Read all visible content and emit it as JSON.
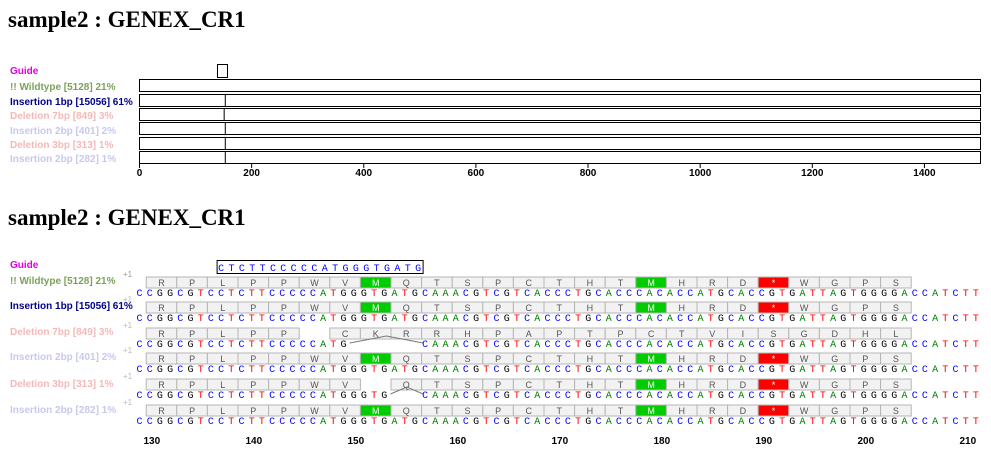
{
  "titles": [
    "sample2 : GENEX_CR1",
    "sample2 : GENEX_CR1"
  ],
  "colors": {
    "guide": "#e000e0",
    "wildtype": "#7aa35a",
    "insertion": "#00008b",
    "faded_red": "#f5b8b8",
    "faded_blue": "#c8c8ef",
    "A": "#008000",
    "C": "#0000ff",
    "G": "#000000",
    "T": "#ff0000",
    "met": "#00cc00",
    "stop": "#ff0000"
  },
  "rows": [
    {
      "label": "Guide",
      "color": "#e000e0"
    },
    {
      "label": "!! Wildtype [5128] 21%",
      "color": "#7aa35a"
    },
    {
      "label": "Insertion 1bp [15056] 61%",
      "color": "#00008b"
    },
    {
      "label": "Deletion 7bp [849] 3%",
      "color": "#f5b8b8"
    },
    {
      "label": "Insertion 2bp [401] 2%",
      "color": "#c8c8ef"
    },
    {
      "label": "Deletion 3bp [313] 1%",
      "color": "#f5b8b8"
    },
    {
      "label": "Insertion 2bp [282] 1%",
      "color": "#c8c8ef"
    }
  ],
  "overview": {
    "axis_min": 0,
    "axis_max": 1500,
    "ticks": [
      "0",
      "200",
      "400",
      "600",
      "800",
      "1000",
      "1200",
      "1400"
    ],
    "tick_values": [
      0,
      200,
      400,
      600,
      800,
      1000,
      1200,
      1400
    ],
    "seq_end": 1500,
    "guide_span": [
      138,
      157
    ],
    "event_pos": [
      151,
      153,
      151,
      153,
      153,
      153
    ]
  },
  "detail": {
    "start": 129,
    "guide_seq": "CTCTTCCCCCATGGGTGATG",
    "guide_start": 137,
    "ticks": [
      "130",
      "140",
      "150",
      "160",
      "170",
      "180",
      "190",
      "200",
      "210"
    ],
    "tick_values": [
      130,
      140,
      150,
      160,
      170,
      180,
      190,
      200,
      210
    ],
    "frame_marks": [
      "+1",
      "+1",
      "+1",
      "+1",
      "+1",
      "+1"
    ],
    "sequences": [
      "CCGGCGTCCTCTTCCCCCATGGGTGATGCAAACGTCGTCACCCTGCACCCACACCATGCACCGTGATTAGTGGGGACCATCTT",
      "CCGGCGTCCTCTTCCCCCATGGGTGATGCAAACGTCGTCACCCTGCACCCACACCATGCACCGTGATTAGTGGGGACCATCTT",
      "CCGGCGTCCTCTTCCCCCATG-------CAAACGTCGTCACCCTGCACCCACACCATGCACCGTGATTAGTGGGGACCATCTT",
      "CCGGCGTCCTCTTCCCCCATGGGTGATGCAAACGTCGTCACCCTGCACCCACACCATGCACCGTGATTAGTGGGGACCATCTT",
      "CCGGCGTCCTCTTCCCCCATGGGTG---CAAACGTCGTCACCCTGCACCCACACCATGCACCGTGATTAGTGGGGACCATCTT",
      "CCGGCGTCCTCTTCCCCCATGGGTGATGCAAACGTCGTCACCCTGCACCCACACCATGCACCGTGATTAGTGGGGACCATCTT"
    ],
    "aa_tracks": [
      [
        "R",
        "P",
        "L",
        "P",
        "P",
        "W",
        "V",
        "M",
        "Q",
        "T",
        "S",
        "P",
        "C",
        "T",
        "H",
        "T",
        "M",
        "H",
        "R",
        "D",
        "*",
        "W",
        "G",
        "P",
        "S"
      ],
      [
        "R",
        "P",
        "L",
        "P",
        "P",
        "W",
        "V",
        "M",
        "Q",
        "T",
        "S",
        "P",
        "C",
        "T",
        "H",
        "T",
        "M",
        "H",
        "R",
        "D",
        "*",
        "W",
        "G",
        "P",
        "S"
      ],
      [
        "R",
        "P",
        "L",
        "P",
        "P",
        "",
        "C",
        "K",
        "R",
        "R",
        "H",
        "P",
        "A",
        "P",
        "T",
        "P",
        "C",
        "T",
        "V",
        "I",
        "S",
        "G",
        "D",
        "H",
        "L"
      ],
      [
        "R",
        "P",
        "L",
        "P",
        "P",
        "W",
        "V",
        "M",
        "Q",
        "T",
        "S",
        "P",
        "C",
        "T",
        "H",
        "T",
        "M",
        "H",
        "R",
        "D",
        "*",
        "W",
        "G",
        "P",
        "S"
      ],
      [
        "R",
        "P",
        "L",
        "P",
        "P",
        "W",
        "V",
        "",
        "Q",
        "T",
        "S",
        "P",
        "C",
        "T",
        "H",
        "T",
        "M",
        "H",
        "R",
        "D",
        "*",
        "W",
        "G",
        "P",
        "S"
      ],
      [
        "R",
        "P",
        "L",
        "P",
        "P",
        "W",
        "V",
        "M",
        "Q",
        "T",
        "S",
        "P",
        "C",
        "T",
        "H",
        "T",
        "M",
        "H",
        "R",
        "D",
        "*",
        "W",
        "G",
        "P",
        "S"
      ]
    ]
  }
}
